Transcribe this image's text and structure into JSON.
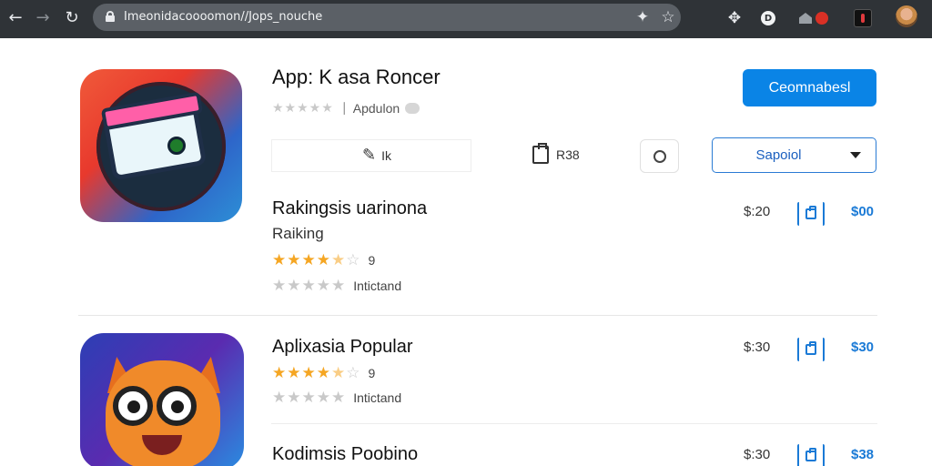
{
  "browser": {
    "url": "Imeonidacoooomon//Jops_nouche"
  },
  "app": {
    "title": "App: K asa Roncer",
    "publisher": "Apdulon",
    "rating_stars": 0,
    "install_label": "Ceomnabesl",
    "action_1_label": "Ik",
    "action_2_label": "R38",
    "select_value": "Sapoiol"
  },
  "sections": [
    {
      "title": "Rakingsis uarinona",
      "subtitle": "Raiking",
      "rating_stars": 4.5,
      "rating_count": "9",
      "secondary_stars": 0,
      "secondary_label": "Intictand",
      "price": "$:20",
      "buy_price": "$00"
    },
    {
      "title": "Aplixasia Popular",
      "rating_stars": 4.5,
      "rating_count": "9",
      "secondary_stars": 0,
      "secondary_label": "Intictand",
      "price": "$:30",
      "buy_price": "$30"
    },
    {
      "title": "Kodimsis Poobino",
      "price": "$:30",
      "buy_price": "$38"
    }
  ],
  "colors": {
    "accent": "#0a84e6",
    "star": "#f5a623",
    "toolbar": "#2f3337"
  },
  "icons": [
    "back-icon",
    "forward-icon",
    "reload-icon",
    "lock-icon",
    "extension-icon",
    "bookmark-star-icon",
    "pin-icon",
    "profile-icon",
    "pencil-icon",
    "clipboard-icon",
    "shopping-bag-icon"
  ]
}
